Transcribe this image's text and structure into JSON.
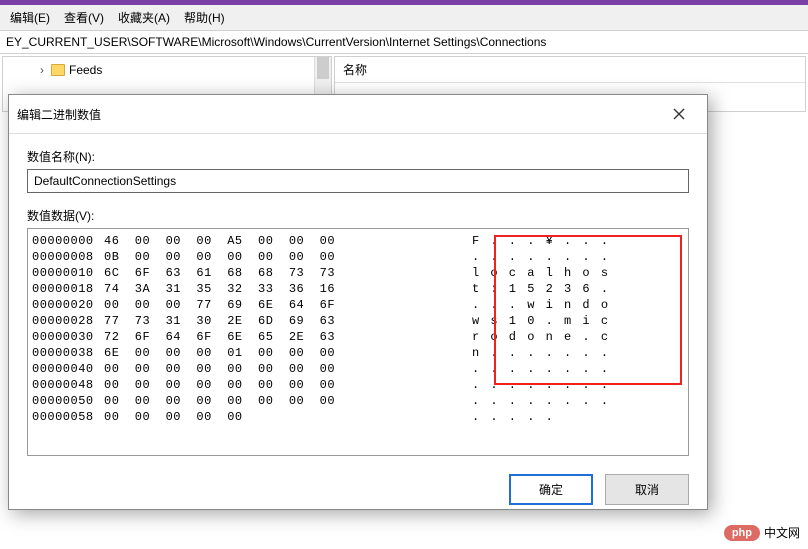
{
  "menubar": {
    "edit": "编辑(E)",
    "view": "查看(V)",
    "favorites": "收藏夹(A)",
    "help": "帮助(H)"
  },
  "path": "EY_CURRENT_USER\\SOFTWARE\\Microsoft\\Windows\\CurrentVersion\\Internet Settings\\Connections",
  "tree": {
    "items": [
      {
        "label": "Feeds",
        "expandable": true
      }
    ]
  },
  "list": {
    "header_name": "名称"
  },
  "dialog": {
    "title": "编辑二进制数值",
    "name_label": "数值名称(N):",
    "name_value": "DefaultConnectionSettings",
    "data_label": "数值数据(V):",
    "ok": "确定",
    "cancel": "取消"
  },
  "hex": {
    "rows": [
      {
        "off": "00000000",
        "b": "46  00  00  00  A5  00  00  00",
        "a": "F . . . ¥ . . ."
      },
      {
        "off": "00000008",
        "b": "0B  00  00  00  00  00  00  00",
        "a": ". . . . . . . ."
      },
      {
        "off": "00000010",
        "b": "6C  6F  63  61  68  68  73  73",
        "a": "l o c a l h o s"
      },
      {
        "off": "00000018",
        "b": "74  3A  31  35  32  33  36  16",
        "a": "t : 1 5 2 3 6 ."
      },
      {
        "off": "00000020",
        "b": "00  00  00  77  69  6E  64  6F",
        "a": ". . . w i n d o"
      },
      {
        "off": "00000028",
        "b": "77  73  31  30  2E  6D  69  63",
        "a": "w s 1 0 . m i c"
      },
      {
        "off": "00000030",
        "b": "72  6F  64  6F  6E  65  2E  63",
        "a": "r o d o n e . c"
      },
      {
        "off": "00000038",
        "b": "6E  00  00  00  01  00  00  00",
        "a": "n . . . . . . ."
      },
      {
        "off": "00000040",
        "b": "00  00  00  00  00  00  00  00",
        "a": ". . . . . . . ."
      },
      {
        "off": "00000048",
        "b": "00  00  00  00  00  00  00  00",
        "a": ". . . . . . . ."
      },
      {
        "off": "00000050",
        "b": "00  00  00  00  00  00  00  00",
        "a": ". . . . . . . ."
      },
      {
        "off": "00000058",
        "b": "00  00  00  00  00",
        "a": ". . . . ."
      }
    ]
  },
  "badge": {
    "label": "php",
    "text": "中文网"
  }
}
